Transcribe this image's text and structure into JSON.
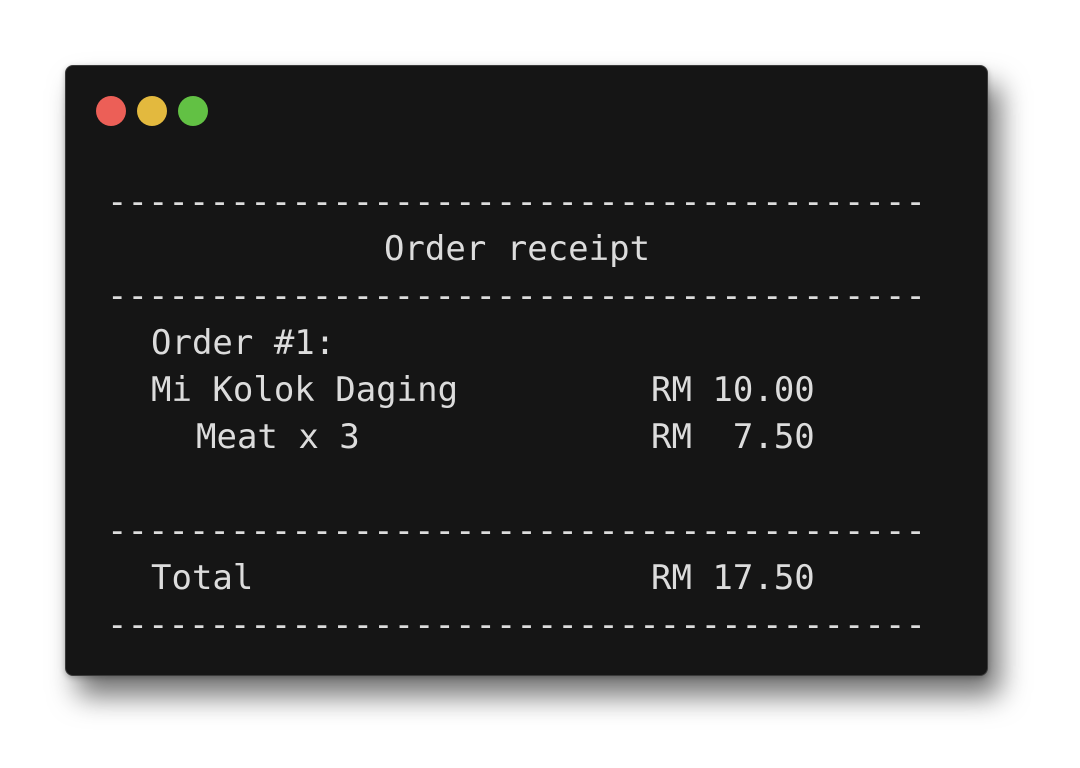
{
  "window": {
    "controls": {
      "close_color": "#ec5f57",
      "minimize_color": "#e3b93e",
      "maximize_color": "#62c144"
    }
  },
  "receipt": {
    "rule": "--------------------------------------------",
    "title": "Order receipt",
    "order_label": "Order #1:",
    "items": [
      {
        "name": "Mi Kolok Daging",
        "price": "RM 10.00"
      },
      {
        "name": "Meat x 3",
        "price": "RM  7.50"
      }
    ],
    "total_label": "Total",
    "total_value": "RM 17.50"
  }
}
